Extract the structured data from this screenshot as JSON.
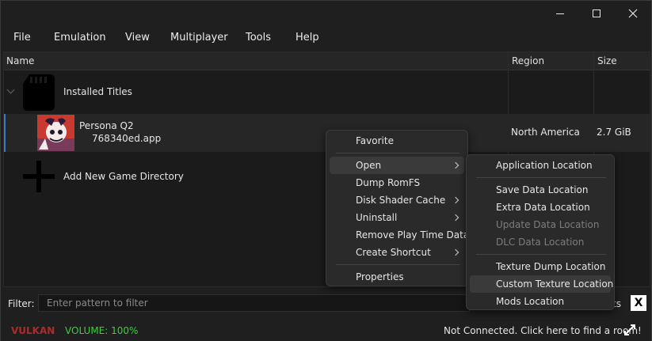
{
  "window": {
    "minimize_icon": "minimize-icon",
    "maximize_icon": "maximize-icon",
    "close_icon": "close-icon"
  },
  "menubar": {
    "items": [
      "File",
      "Emulation",
      "View",
      "Multiplayer",
      "Tools",
      "Help"
    ]
  },
  "columns": {
    "name": "Name",
    "region": "Region",
    "size": "Size"
  },
  "tree": {
    "installed": {
      "label": "Installed Titles",
      "icon": "sd-card-icon"
    },
    "game": {
      "title": "Persona Q2",
      "file": "768340ed.app",
      "region": "North America",
      "size": "2.7 GiB",
      "icon": "game-icon"
    },
    "add": {
      "label": "Add New Game Directory",
      "icon": "plus-icon"
    }
  },
  "context_menu": {
    "items": [
      "Favorite",
      "Open",
      "Dump RomFS",
      "Disk Shader Cache",
      "Uninstall",
      "Remove Play Time Data",
      "Create Shortcut",
      "Properties"
    ]
  },
  "open_submenu": {
    "items": [
      "Application Location",
      "Save Data Location",
      "Extra Data Location",
      "Update Data Location",
      "DLC Data Location",
      "Texture Dump Location",
      "Custom Texture Location",
      "Mods Location"
    ]
  },
  "filter": {
    "label": "Filter:",
    "placeholder": "Enter pattern to filter",
    "count_suffix": "ts",
    "clear": "X"
  },
  "status": {
    "renderer": "VULKAN",
    "volume": "VOLUME: 100%",
    "room": "Not Connected. Click here to find a room!",
    "network_icon": "network-icon"
  },
  "colors": {
    "renderer": "#b02a2a",
    "volume": "#39d13b",
    "selection_border": "#3c78c8"
  }
}
